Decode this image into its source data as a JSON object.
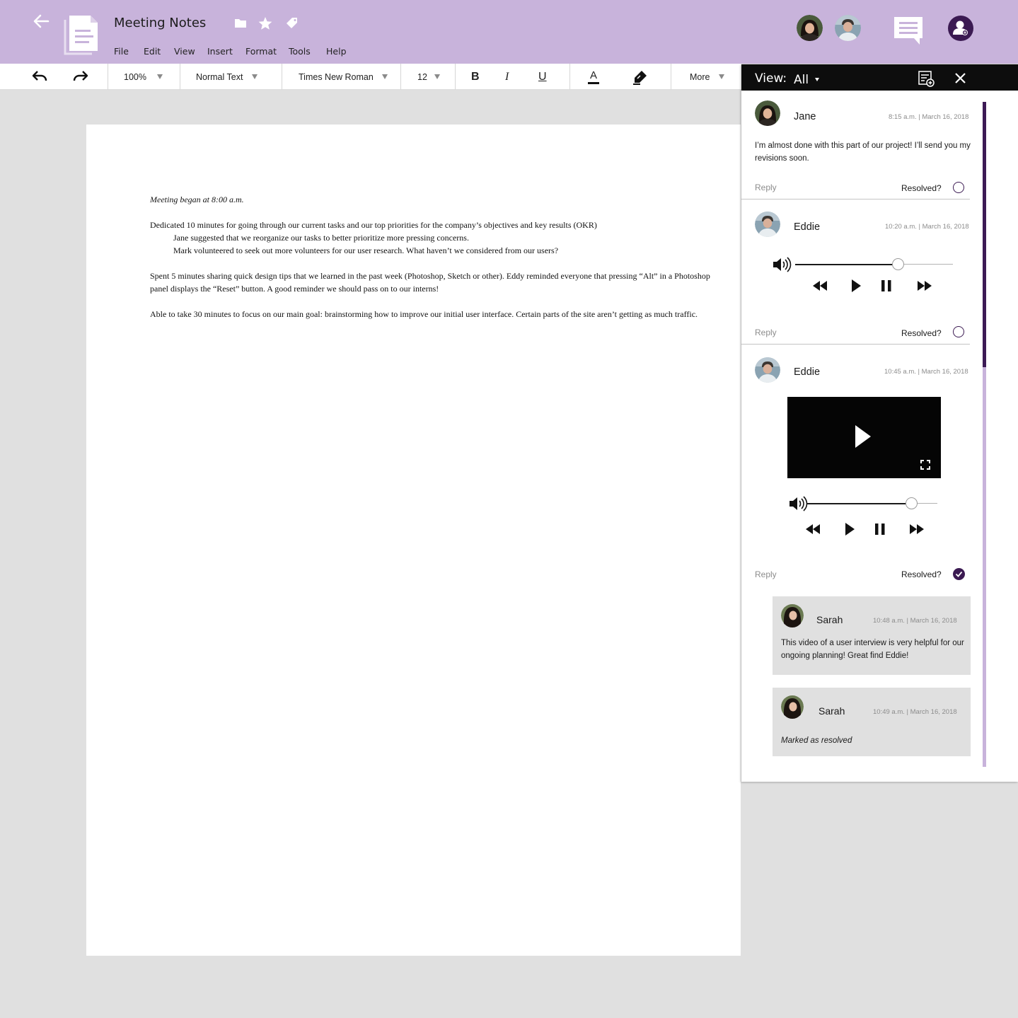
{
  "header": {
    "doc_title": "Meeting Notes",
    "menu": [
      "File",
      "Edit",
      "View",
      "Insert",
      "Format",
      "Tools",
      "Help"
    ],
    "colors": {
      "bar": "#c8b3db",
      "accent": "#3b1a52"
    }
  },
  "toolbar": {
    "zoom": "100%",
    "style": "Normal Text",
    "font": "Times New Roman",
    "size": "12",
    "bold": "B",
    "italic": "I",
    "underline": "U",
    "text_color": "A",
    "more": "More"
  },
  "document": {
    "p1": "Meeting began at 8:00 a.m.",
    "p2": "Dedicated 10 minutes for going through our current tasks and our top priorities for the company’s objectives and key results (OKR)",
    "p2a": "Jane suggested that we reorganize our tasks to better prioritize more pressing concerns.",
    "p2b": "Mark volunteered to seek out more volunteers for our user research. What haven’t we considered from our users?",
    "p3": "Spent 5 minutes sharing quick design tips that we learned in the past week (Photoshop, Sketch or other). Eddy reminded everyone that pressing “Alt” in a Photoshop panel displays the “Reset” button. A good reminder we should pass on to our interns!",
    "p4": "Able to take 30 minutes to focus on our main goal: brainstorming how to improve our initial user interface. Certain parts of the site aren’t getting as much traffic."
  },
  "panel": {
    "view_label": "View:",
    "view_value": "All",
    "comments": [
      {
        "name": "Jane",
        "time": "8:15 a.m. | March 16, 2018",
        "body": "I’m almost done with this part of our project! I’ll send you my revisions soon.",
        "reply": "Reply",
        "resolved_label": "Resolved?",
        "resolved": false
      },
      {
        "name": "Eddie",
        "time": "10:20 a.m. | March 16, 2018",
        "media": "audio",
        "volume": 0.7,
        "reply": "Reply",
        "resolved_label": "Resolved?",
        "resolved": false
      },
      {
        "name": "Eddie",
        "time": "10:45 a.m. | March 16, 2018",
        "media": "video",
        "volume": 0.8,
        "reply": "Reply",
        "resolved_label": "Resolved?",
        "resolved": true,
        "replies": [
          {
            "name": "Sarah",
            "time": "10:48 a.m. | March 16, 2018",
            "body": "This video of a user interview is very helpful for our ongoing planning! Great find Eddie!"
          },
          {
            "name": "Sarah",
            "time": "10:49 a.m. | March 16, 2018",
            "body": "Marked as resolved"
          }
        ]
      }
    ]
  }
}
